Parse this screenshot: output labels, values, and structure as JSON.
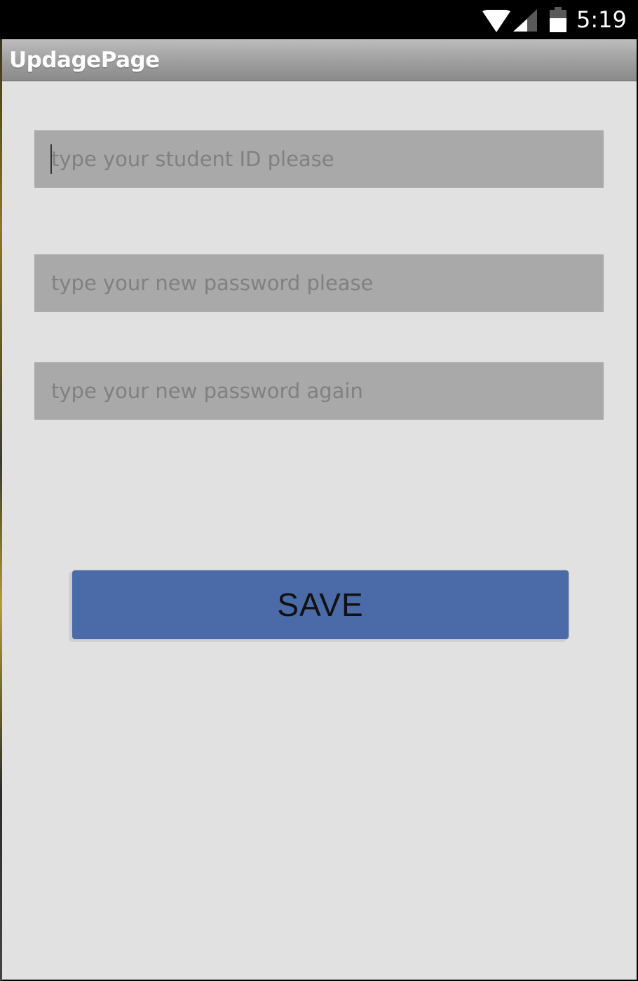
{
  "status_bar": {
    "time": "5:19",
    "icons": [
      "wifi-icon",
      "signal-icon",
      "battery-icon"
    ]
  },
  "action_bar": {
    "title": "UpdagePage",
    "background": "#9e9e9e"
  },
  "form": {
    "student_id": {
      "value": "",
      "placeholder": "type your student ID please"
    },
    "new_password": {
      "value": "",
      "placeholder": "type your new password please"
    },
    "confirm_password": {
      "value": "",
      "placeholder": "type your new password again"
    },
    "save_label": "SAVE"
  },
  "colors": {
    "content_background": "#e1e1e1",
    "field_background": "#a9a9a9",
    "save_button": "#4a6ba8"
  }
}
